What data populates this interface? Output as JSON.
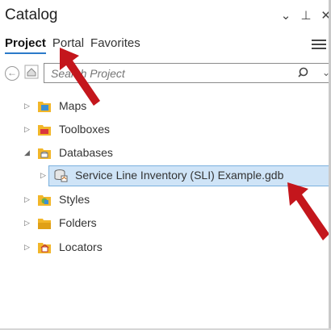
{
  "header": {
    "title": "Catalog",
    "dropdown_glyph": "⌄",
    "pin_glyph": "⊥",
    "close_glyph": "✕"
  },
  "tabs": [
    {
      "label": "Project",
      "active": true
    },
    {
      "label": "Portal",
      "active": false
    },
    {
      "label": "Favorites",
      "active": false
    }
  ],
  "search": {
    "placeholder": "Search Project",
    "back_glyph": "←",
    "dropdown_glyph": "⌄"
  },
  "tree": {
    "items": [
      {
        "label": "Maps",
        "icon": "maps-folder-icon",
        "expanded": false
      },
      {
        "label": "Toolboxes",
        "icon": "toolbox-folder-icon",
        "expanded": false
      },
      {
        "label": "Databases",
        "icon": "database-folder-icon",
        "expanded": true
      },
      {
        "label": "Service Line Inventory (SLI) Example.gdb",
        "icon": "geodatabase-icon",
        "expanded": false,
        "selected": true,
        "child": true
      },
      {
        "label": "Styles",
        "icon": "styles-folder-icon",
        "expanded": false
      },
      {
        "label": "Folders",
        "icon": "folders-folder-icon",
        "expanded": false
      },
      {
        "label": "Locators",
        "icon": "locators-folder-icon",
        "expanded": false
      }
    ]
  },
  "colors": {
    "accent": "#2b7ac9",
    "selection": "#cfe4f7",
    "folder": "#f2b629",
    "annotation_arrow": "#c4161c"
  }
}
